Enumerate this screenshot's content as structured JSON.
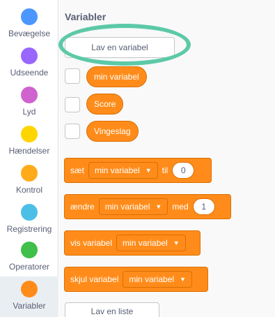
{
  "sidebar": {
    "categories": [
      {
        "label": "Bevægelse",
        "color": "#4c97ff"
      },
      {
        "label": "Udseende",
        "color": "#9966ff"
      },
      {
        "label": "Lyd",
        "color": "#cf63cf"
      },
      {
        "label": "Hændelser",
        "color": "#ffd500"
      },
      {
        "label": "Kontrol",
        "color": "#ffab19"
      },
      {
        "label": "Registrering",
        "color": "#4cbfe6"
      },
      {
        "label": "Operatorer",
        "color": "#40bf4a"
      },
      {
        "label": "Variabler",
        "color": "#ff8c1a"
      }
    ],
    "selected": "Variabler"
  },
  "palette": {
    "section_title": "Variabler",
    "make_variable_label": "Lav en variabel",
    "make_list_label": "Lav en liste",
    "variables": [
      "min variabel",
      "Score",
      "Vingeslag"
    ],
    "blocks": {
      "set": {
        "prefix": "sæt",
        "dropdown": "min variabel",
        "middle": "til",
        "value": "0"
      },
      "change": {
        "prefix": "ændre",
        "dropdown": "min variabel",
        "middle": "med",
        "value": "1"
      },
      "show": {
        "prefix": "vis variabel",
        "dropdown": "min variabel"
      },
      "hide": {
        "prefix": "skjul variabel",
        "dropdown": "min variabel"
      }
    },
    "dropdown_caret": "▼"
  }
}
